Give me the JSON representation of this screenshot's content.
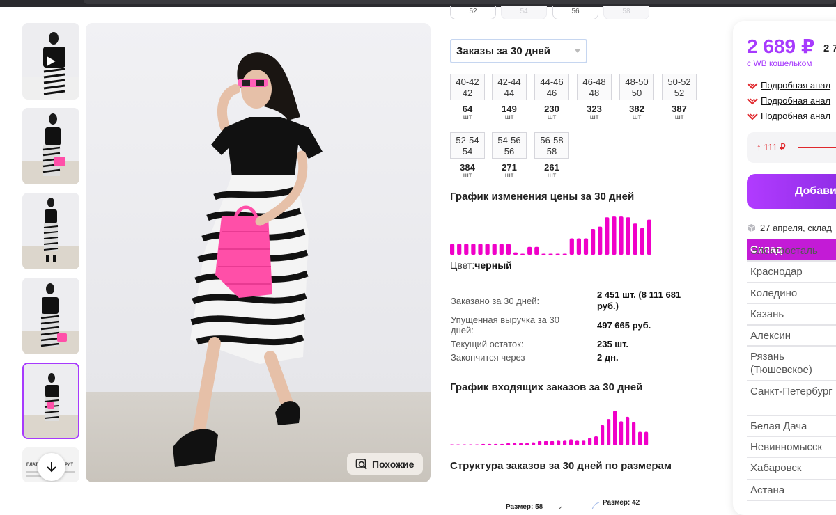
{
  "top_sizes": [
    "52",
    "54",
    "56",
    "58"
  ],
  "thumbs": [
    {
      "name": "video"
    },
    {
      "name": "photo-2"
    },
    {
      "name": "photo-3"
    },
    {
      "name": "photo-4"
    },
    {
      "name": "photo-5"
    },
    {
      "name": "photo-6",
      "lines": [
        "ПЛАТЬ",
        "МЕРИТ"
      ]
    }
  ],
  "similar_label": "Похожие",
  "period_select": "Заказы за 30 дней",
  "sizes": [
    {
      "ru": "40-42",
      "eu": "42",
      "qty": "64",
      "unit": "шт"
    },
    {
      "ru": "42-44",
      "eu": "44",
      "qty": "149",
      "unit": "шт"
    },
    {
      "ru": "44-46",
      "eu": "46",
      "qty": "230",
      "unit": "шт"
    },
    {
      "ru": "46-48",
      "eu": "48",
      "qty": "323",
      "unit": "шт"
    },
    {
      "ru": "48-50",
      "eu": "50",
      "qty": "382",
      "unit": "шт"
    },
    {
      "ru": "50-52",
      "eu": "52",
      "qty": "387",
      "unit": "шт"
    },
    {
      "ru": "52-54",
      "eu": "54",
      "qty": "384",
      "unit": "шт"
    },
    {
      "ru": "54-56",
      "eu": "56",
      "qty": "271",
      "unit": "шт"
    },
    {
      "ru": "56-58",
      "eu": "58",
      "qty": "261",
      "unit": "шт"
    }
  ],
  "price_chart_title": "График изменения цены за 30 дней",
  "price_chart": [
    14,
    14,
    14,
    14,
    14,
    14,
    14,
    14,
    14,
    3,
    1,
    10,
    10,
    1,
    1,
    1,
    1,
    21,
    21,
    21,
    33,
    36,
    48,
    49,
    49,
    48,
    40,
    34,
    45
  ],
  "color_label": "Цвет:",
  "color_value": "черный",
  "stats": [
    {
      "label": "Заказано за 30 дней:",
      "value": "2 451 шт. (8 111 681 руб.)"
    },
    {
      "label": "Упущенная выручка за 30 дней:",
      "value": "497 665 руб."
    },
    {
      "label": "Текущий остаток:",
      "value": "235 шт."
    },
    {
      "label": "Закончится через",
      "value": "2 дн."
    }
  ],
  "orders_chart_title": "График входящих заказов за 30 дней",
  "orders_chart": [
    1,
    1,
    1,
    1,
    1,
    2,
    2,
    2,
    2,
    3,
    3,
    3,
    3,
    4,
    6,
    6,
    6,
    7,
    7,
    8,
    7,
    7,
    10,
    12,
    27,
    35,
    46,
    32,
    38,
    31,
    18,
    18
  ],
  "structure_title": "Структура заказов за 30 дней по размерам",
  "donut_labels": [
    "Размер: 58",
    "Размер: 42"
  ],
  "product": {
    "price": "2 689 ₽",
    "price_old": "2 7",
    "wallet": "с WB кошельком",
    "analysis_links": [
      "Подробная анал",
      "Подробная анал",
      "Подробная анал"
    ],
    "delta": "↑ 111 ₽",
    "add_button": "Добави",
    "delivery": "27 апреля, склад"
  },
  "warehouses": {
    "header": "Склад",
    "rows": [
      "Электросталь",
      "Краснодар",
      "Коледино",
      "Казань",
      "Алексин",
      "Рязань (Тюшевское)",
      "Санкт-Петербург",
      "Белая Дача",
      "Невинномысск",
      "Хабаровск",
      "Астана"
    ]
  },
  "colors": {
    "accent": "#a73afd",
    "chart": "#f000c8",
    "warehouse_head": "#c31bd6",
    "delta": "#e0282d"
  }
}
